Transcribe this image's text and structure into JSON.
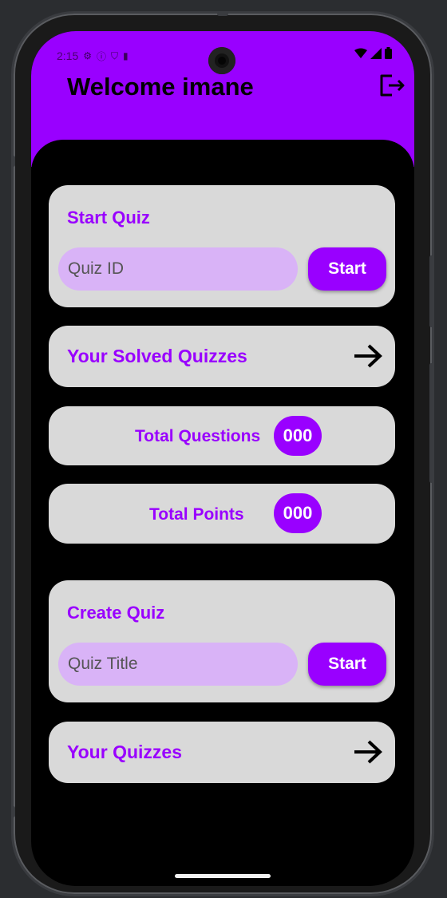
{
  "status_bar": {
    "time": "2:15",
    "icons": [
      "settings-icon",
      "info-icon",
      "shield-icon",
      "sd-card-icon"
    ],
    "right_icons": [
      "wifi-icon",
      "signal-icon",
      "battery-icon"
    ]
  },
  "header": {
    "title": "Welcome imane",
    "logout_icon": "logout-icon"
  },
  "start_quiz": {
    "title": "Start Quiz",
    "input_placeholder": "Quiz ID",
    "button_label": "Start"
  },
  "solved_quizzes": {
    "label": "Your Solved Quizzes",
    "icon": "arrow-right-icon"
  },
  "total_questions": {
    "label": "Total Questions",
    "value": "000"
  },
  "total_points": {
    "label": "Total Points",
    "value": "000"
  },
  "create_quiz": {
    "title": "Create Quiz",
    "input_placeholder": "Quiz Title",
    "button_label": "Start"
  },
  "your_quizzes": {
    "label": "Your Quizzes",
    "icon": "arrow-right-icon"
  },
  "colors": {
    "accent": "#9900ff",
    "card_bg": "#d9d9d9",
    "input_bg": "#d9b3f7",
    "screen_bg": "#000000"
  }
}
